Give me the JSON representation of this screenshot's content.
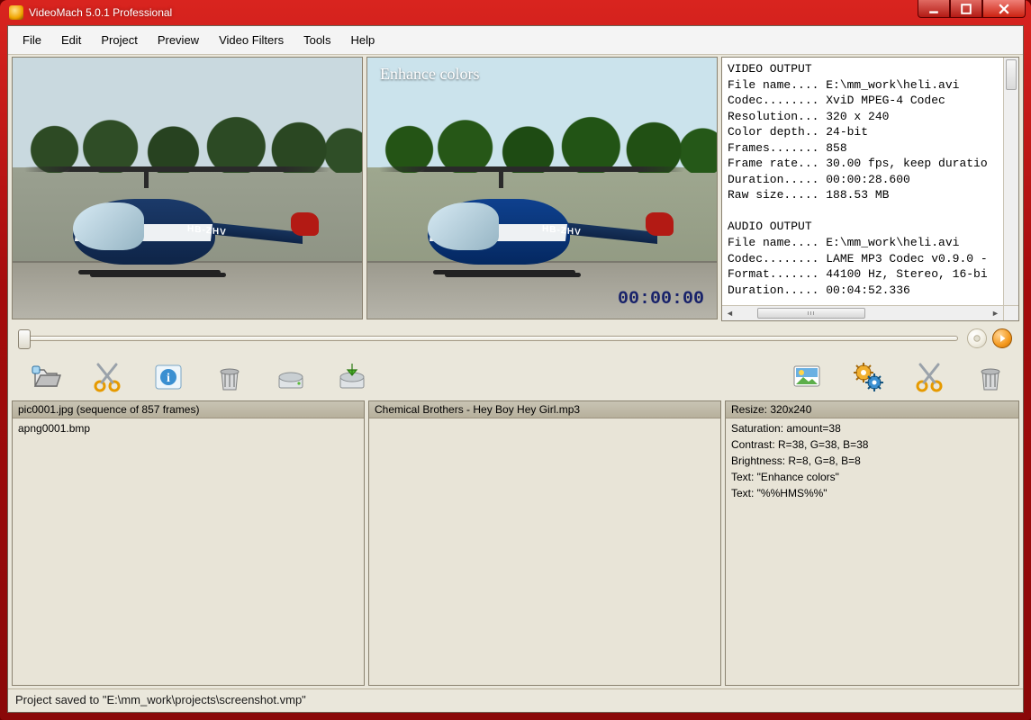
{
  "window": {
    "title": "VideoMach 5.0.1 Professional"
  },
  "menu": {
    "file": "File",
    "edit": "Edit",
    "project": "Project",
    "preview": "Preview",
    "video_filters": "Video Filters",
    "tools": "Tools",
    "help": "Help"
  },
  "preview": {
    "overlay_label": "Enhance colors",
    "overlay_time": "00:00:00",
    "tail_reg": "HB-ZHV"
  },
  "output_info": {
    "lines": "VIDEO OUTPUT\nFile name.... E:\\mm_work\\heli.avi\nCodec........ XviD MPEG-4 Codec\nResolution... 320 x 240\nColor depth.. 24-bit\nFrames....... 858\nFrame rate... 30.00 fps, keep duratio\nDuration..... 00:00:28.600\nRaw size..... 188.53 MB\n\nAUDIO OUTPUT\nFile name.... E:\\mm_work\\heli.avi\nCodec........ LAME MP3 Codec v0.9.0 -\nFormat....... 44100 Hz, Stereo, 16-bi\nDuration..... 00:04:52.336"
  },
  "panels": {
    "files": {
      "header": "pic0001.jpg  (sequence of 857 frames)",
      "items": [
        "apng0001.bmp"
      ]
    },
    "audio": {
      "header": "Chemical Brothers - Hey Boy Hey Girl.mp3",
      "items": []
    },
    "filters": {
      "header": "Resize:  320x240",
      "items": [
        "Saturation:  amount=38",
        "Contrast:  R=38, G=38, B=38",
        "Brightness:  R=8, G=8, B=8",
        "Text:  \"Enhance colors\"",
        "Text:  \"%%HMS%%\""
      ]
    }
  },
  "status": {
    "text": "Project saved to \"E:\\mm_work\\projects\\screenshot.vmp\""
  }
}
